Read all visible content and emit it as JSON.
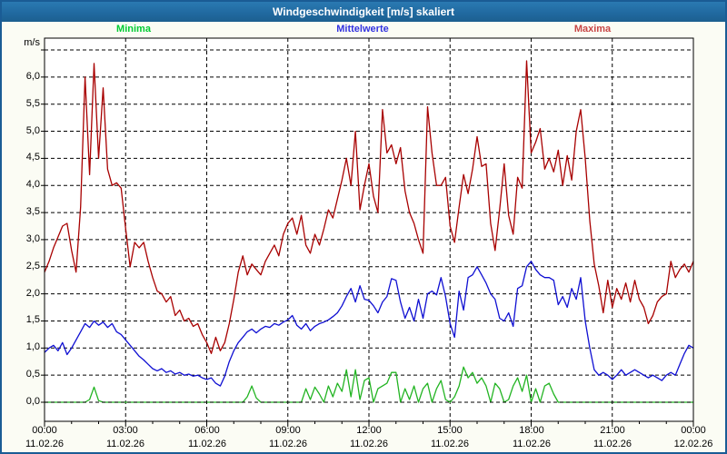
{
  "window": {
    "title": "Windgeschwindigkeit [m/s] skaliert"
  },
  "legend": {
    "items": [
      {
        "label": "Minima",
        "color": "#00CC33"
      },
      {
        "label": "Mittelwerte",
        "color": "#3333E0"
      },
      {
        "label": "Maxima",
        "color": "#C84646"
      }
    ]
  },
  "chart_data": {
    "type": "line",
    "title": "Windgeschwindigkeit [m/s] skaliert",
    "ylabel": "m/s",
    "xlabel": "",
    "ylim": [
      -0.35,
      6.68
    ],
    "grid": "dashed-black",
    "legend_position": "top",
    "y_gridline_step": 0.5,
    "y_gridlines": [
      0.0,
      0.5,
      1.0,
      1.5,
      2.0,
      2.5,
      3.0,
      3.5,
      4.0,
      4.5,
      5.0,
      5.5,
      6.0,
      6.5
    ],
    "y_tick_labels": [
      {
        "v": 6.0,
        "label": "6,0"
      },
      {
        "v": 5.5,
        "label": "5,5"
      },
      {
        "v": 5.0,
        "label": "5,0"
      },
      {
        "v": 4.5,
        "label": "4,5"
      },
      {
        "v": 4.0,
        "label": "4,0"
      },
      {
        "v": 3.5,
        "label": "3,5"
      },
      {
        "v": 3.0,
        "label": "3,0"
      },
      {
        "v": 2.5,
        "label": "2,5"
      },
      {
        "v": 2.0,
        "label": "2,0"
      },
      {
        "v": 1.5,
        "label": "1,5"
      },
      {
        "v": 1.0,
        "label": "1,0"
      },
      {
        "v": 0.5,
        "label": "0,5"
      },
      {
        "v": 0.0,
        "label": "0,0"
      }
    ],
    "x_axis": {
      "range_hours": [
        0,
        24
      ],
      "major_tick_hours": 3,
      "minor_tick_hours": 1,
      "vertical_gridlines_hours": [
        3,
        6,
        9,
        12,
        15,
        18,
        21
      ],
      "tick_labels": [
        {
          "hour": 0,
          "time": "00:00",
          "date": "11.02.26"
        },
        {
          "hour": 3,
          "time": "03:00",
          "date": "11.02.26"
        },
        {
          "hour": 6,
          "time": "06:00",
          "date": "11.02.26"
        },
        {
          "hour": 9,
          "time": "09:00",
          "date": "11.02.26"
        },
        {
          "hour": 12,
          "time": "12:00",
          "date": "11.02.26"
        },
        {
          "hour": 15,
          "time": "15:00",
          "date": "11.02.26"
        },
        {
          "hour": 18,
          "time": "18:00",
          "date": "11.02.26"
        },
        {
          "hour": 21,
          "time": "21:00",
          "date": "11.02.26"
        },
        {
          "hour": 24,
          "time": "00:00",
          "date": "12.02.26"
        }
      ]
    },
    "series": [
      {
        "name": "Minima",
        "color": "#22B422",
        "x_start_hours": 0,
        "x_step_minutes": 10,
        "values": [
          0,
          0,
          0,
          0,
          0,
          0,
          0,
          0,
          0,
          0,
          0.05,
          0.28,
          0.03,
          0,
          0,
          0,
          0,
          0,
          0,
          0,
          0,
          0,
          0,
          0,
          0,
          0,
          0,
          0,
          0,
          0,
          0,
          0,
          0,
          0,
          0,
          0,
          0,
          0,
          0,
          0,
          0,
          0,
          0,
          0,
          0,
          0.1,
          0.3,
          0.08,
          0,
          0,
          0,
          0,
          0,
          0,
          0,
          0,
          0,
          0,
          0.25,
          0.05,
          0.28,
          0.15,
          0,
          0.3,
          0.1,
          0.35,
          0.2,
          0.6,
          0.1,
          0.6,
          0.05,
          0.4,
          0.45,
          0,
          0.25,
          0.3,
          0.35,
          0.55,
          0.55,
          0,
          0.25,
          0.05,
          0.3,
          0,
          0.25,
          0.35,
          0,
          0.25,
          0.4,
          0.05,
          0,
          0.1,
          0.3,
          0.65,
          0.45,
          0.55,
          0.35,
          0.45,
          0.3,
          0,
          0.35,
          0.25,
          0,
          0.05,
          0.3,
          0.45,
          0.2,
          0.5,
          0,
          0.25,
          0,
          0.3,
          0.35,
          0.15,
          0,
          0,
          0,
          0,
          0,
          0,
          0,
          0,
          0,
          0,
          0,
          0,
          0,
          0,
          0,
          0,
          0,
          0,
          0,
          0,
          0,
          0,
          0,
          0,
          0,
          0,
          0,
          0,
          0,
          0,
          0
        ]
      },
      {
        "name": "Mittelwerte",
        "color": "#0F0FD2",
        "x_start_hours": 0,
        "x_step_minutes": 10,
        "values": [
          0.92,
          1.0,
          1.05,
          0.95,
          1.1,
          0.88,
          1.0,
          1.15,
          1.3,
          1.45,
          1.38,
          1.5,
          1.42,
          1.48,
          1.38,
          1.45,
          1.3,
          1.25,
          1.15,
          1.05,
          0.95,
          0.85,
          0.78,
          0.7,
          0.62,
          0.58,
          0.62,
          0.55,
          0.58,
          0.52,
          0.55,
          0.5,
          0.52,
          0.48,
          0.5,
          0.45,
          0.42,
          0.45,
          0.35,
          0.3,
          0.48,
          0.75,
          0.95,
          1.1,
          1.2,
          1.3,
          1.35,
          1.28,
          1.35,
          1.4,
          1.38,
          1.45,
          1.42,
          1.48,
          1.52,
          1.6,
          1.42,
          1.35,
          1.45,
          1.32,
          1.4,
          1.45,
          1.48,
          1.52,
          1.58,
          1.65,
          1.78,
          1.95,
          2.1,
          1.85,
          2.15,
          1.9,
          1.88,
          1.78,
          1.65,
          1.85,
          1.95,
          2.28,
          2.25,
          1.85,
          1.55,
          1.75,
          1.5,
          1.9,
          1.55,
          2.0,
          2.05,
          1.98,
          2.3,
          1.95,
          1.45,
          1.2,
          2.05,
          1.7,
          2.3,
          2.35,
          2.5,
          2.35,
          2.2,
          2.0,
          1.9,
          1.55,
          1.5,
          1.65,
          1.4,
          2.1,
          2.15,
          2.5,
          2.6,
          2.45,
          2.35,
          2.3,
          2.3,
          2.25,
          1.8,
          1.95,
          1.75,
          2.1,
          1.9,
          2.3,
          1.5,
          1.0,
          0.6,
          0.5,
          0.55,
          0.5,
          0.42,
          0.5,
          0.6,
          0.5,
          0.55,
          0.6,
          0.55,
          0.5,
          0.45,
          0.5,
          0.45,
          0.4,
          0.5,
          0.55,
          0.5,
          0.7,
          0.9,
          1.05,
          1.0
        ]
      },
      {
        "name": "Maxima",
        "color": "#A80000",
        "x_start_hours": 0,
        "x_step_minutes": 10,
        "values": [
          2.4,
          2.6,
          2.85,
          3.05,
          3.25,
          3.3,
          2.8,
          2.4,
          3.6,
          6.0,
          4.2,
          6.25,
          4.5,
          5.8,
          4.3,
          4.0,
          4.05,
          3.95,
          3.2,
          2.5,
          2.95,
          2.85,
          2.95,
          2.6,
          2.3,
          2.05,
          2.0,
          1.85,
          1.95,
          1.6,
          1.7,
          1.5,
          1.55,
          1.4,
          1.45,
          1.25,
          1.1,
          0.9,
          1.2,
          0.95,
          1.1,
          1.45,
          1.9,
          2.4,
          2.7,
          2.35,
          2.55,
          2.45,
          2.35,
          2.6,
          2.75,
          2.9,
          2.7,
          3.1,
          3.3,
          3.4,
          3.1,
          3.45,
          2.9,
          2.75,
          3.1,
          2.9,
          3.2,
          3.55,
          3.4,
          3.75,
          4.1,
          4.5,
          4.0,
          5.0,
          3.55,
          4.0,
          4.4,
          3.8,
          3.5,
          5.4,
          4.6,
          4.75,
          4.4,
          4.7,
          3.9,
          3.5,
          3.3,
          3.0,
          2.75,
          5.45,
          4.6,
          4.0,
          4.0,
          4.15,
          3.25,
          2.95,
          3.6,
          4.2,
          3.85,
          4.3,
          4.9,
          4.35,
          4.4,
          3.3,
          2.8,
          3.55,
          4.4,
          3.45,
          3.1,
          4.15,
          3.95,
          6.3,
          4.6,
          4.8,
          5.05,
          4.3,
          4.5,
          4.25,
          4.65,
          4.0,
          4.55,
          4.1,
          5.0,
          5.4,
          4.5,
          3.35,
          2.55,
          2.15,
          1.65,
          2.25,
          1.75,
          2.1,
          1.9,
          2.2,
          1.85,
          2.25,
          1.9,
          1.75,
          1.45,
          1.6,
          1.85,
          1.95,
          2.0,
          2.6,
          2.3,
          2.45,
          2.55,
          2.4,
          2.6
        ]
      }
    ]
  }
}
